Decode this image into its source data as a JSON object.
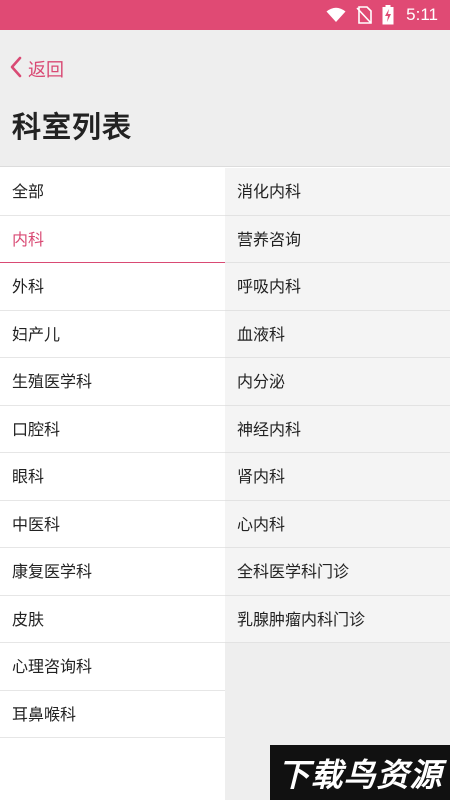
{
  "status_bar": {
    "time": "5:11",
    "background": "#e04a74"
  },
  "header": {
    "back_label": "返回",
    "title": "科室列表"
  },
  "accent_color": "#d94a74",
  "left_categories": [
    {
      "label": "全部"
    },
    {
      "label": "内科",
      "active": true
    },
    {
      "label": "外科"
    },
    {
      "label": "妇产儿"
    },
    {
      "label": "生殖医学科"
    },
    {
      "label": "口腔科"
    },
    {
      "label": "眼科"
    },
    {
      "label": "中医科"
    },
    {
      "label": "康复医学科"
    },
    {
      "label": "皮肤"
    },
    {
      "label": "心理咨询科"
    },
    {
      "label": "耳鼻喉科"
    }
  ],
  "right_departments": [
    {
      "label": "消化内科"
    },
    {
      "label": "营养咨询"
    },
    {
      "label": "呼吸内科"
    },
    {
      "label": "血液科"
    },
    {
      "label": "内分泌"
    },
    {
      "label": "神经内科"
    },
    {
      "label": "肾内科"
    },
    {
      "label": "心内科"
    },
    {
      "label": "全科医学科门诊"
    },
    {
      "label": "乳腺肿瘤内科门诊"
    }
  ],
  "watermark": {
    "text": "下载鸟资源"
  }
}
